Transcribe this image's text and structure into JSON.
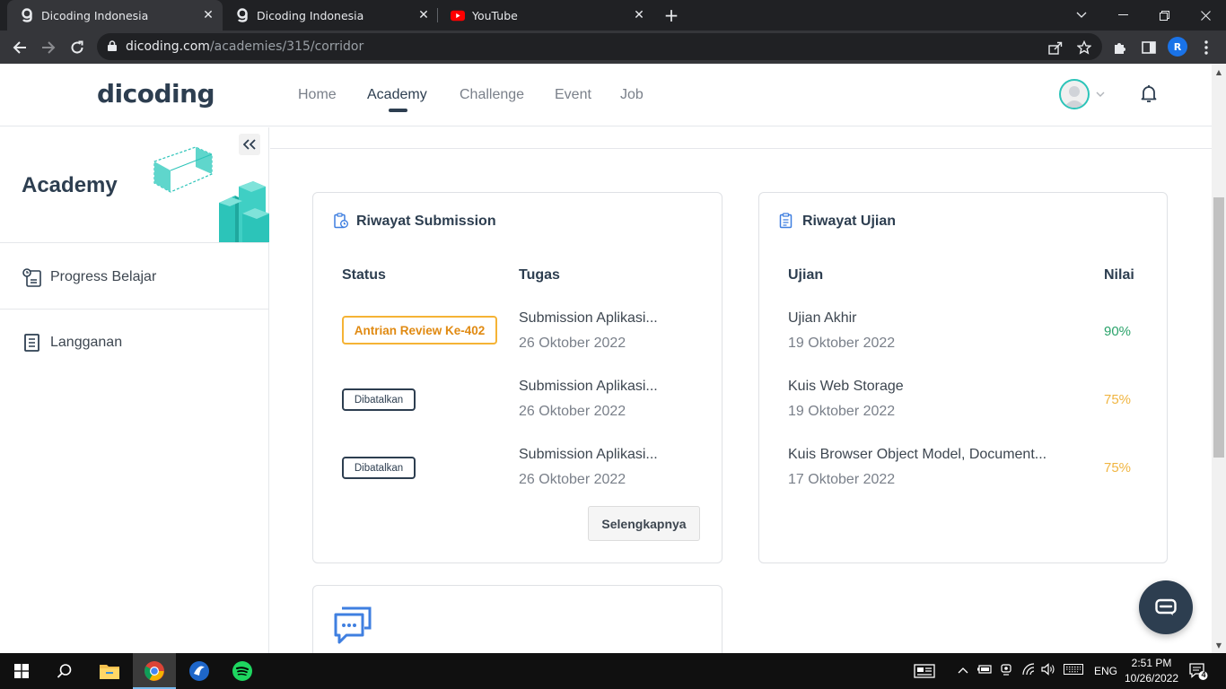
{
  "browser": {
    "tabs": [
      {
        "title": "Dicoding Indonesia",
        "active": true
      },
      {
        "title": "Dicoding Indonesia",
        "active": false
      },
      {
        "title": "YouTube",
        "active": false
      }
    ],
    "url_host": "dicoding.com",
    "url_path": "/academies/315/corridor",
    "profile_initial": "R"
  },
  "header": {
    "logo": "dicoding",
    "nav": [
      "Home",
      "Academy",
      "Challenge",
      "Event",
      "Job"
    ],
    "active_nav": "Academy"
  },
  "sidebar": {
    "title": "Academy",
    "items": [
      {
        "label": "Progress Belajar",
        "icon": "progress-icon"
      },
      {
        "label": "Langganan",
        "icon": "document-icon"
      }
    ]
  },
  "submission_card": {
    "title": "Riwayat Submission",
    "col_status": "Status",
    "col_task": "Tugas",
    "rows": [
      {
        "status": "Antrian Review Ke-402",
        "task": "Submission Aplikasi...",
        "date": "26 Oktober 2022"
      },
      {
        "status": "Dibatalkan",
        "task": "Submission Aplikasi...",
        "date": "26 Oktober 2022"
      },
      {
        "status": "Dibatalkan",
        "task": "Submission Aplikasi...",
        "date": "26 Oktober 2022"
      }
    ],
    "more_button": "Selengkapnya"
  },
  "exam_card": {
    "title": "Riwayat Ujian",
    "col_exam": "Ujian",
    "col_score": "Nilai",
    "rows": [
      {
        "exam": "Ujian Akhir",
        "date": "19 Oktober 2022",
        "score": "90%"
      },
      {
        "exam": "Kuis Web Storage",
        "date": "19 Oktober 2022",
        "score": "75%"
      },
      {
        "exam": "Kuis Browser Object Model, Document...",
        "date": "17 Oktober 2022",
        "score": "75%"
      }
    ]
  },
  "colors": {
    "brand": "#2d3e50",
    "score_high": "#2ba36b",
    "score_mid": "#f0b541",
    "badge_orange": "#f5b335",
    "accent_blue": "#3f7fe0"
  },
  "taskbar": {
    "language": "ENG",
    "time": "2:51 PM",
    "date": "10/26/2022",
    "notifications": "4"
  }
}
